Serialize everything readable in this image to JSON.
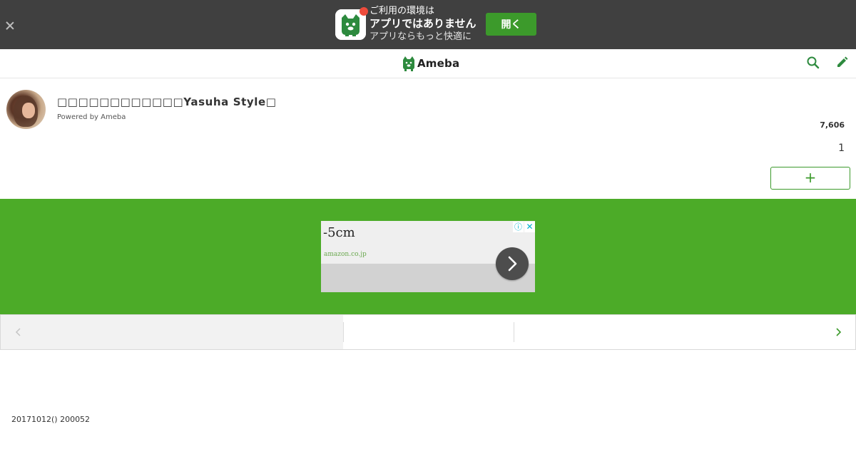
{
  "app_banner": {
    "line1": "ご利用の環境は",
    "line2": "アプリではありません",
    "line3": "アプリならもっと快適に",
    "open_label": "開く",
    "accent_color": "#3c9a2b",
    "badge_color": "#ee4b3b"
  },
  "header": {
    "logo_text": "Ameba",
    "icons": [
      "search-icon",
      "edit-icon"
    ]
  },
  "profile": {
    "blog_title": "Yasuha Style",
    "powered_by": "Powered by Ameba",
    "reader_count": "7,606",
    "rank": "1",
    "follow_label": "+"
  },
  "ad": {
    "headline": "-5cm",
    "domain": "amazon.co.jp",
    "info_glyph": "ⓘ",
    "close_glyph": "✕"
  },
  "post": {
    "date": "20171012() 200052"
  }
}
